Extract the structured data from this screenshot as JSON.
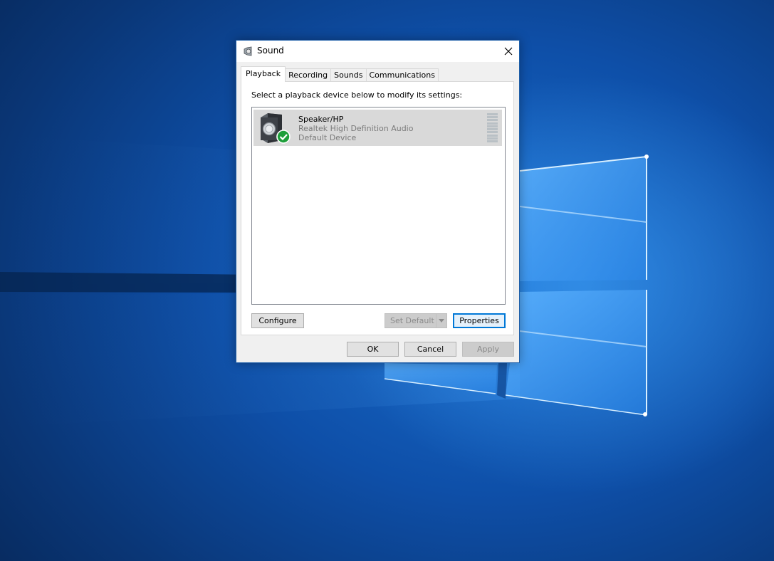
{
  "window": {
    "title": "Sound",
    "close_icon": "close-icon",
    "app_icon": "speaker-icon"
  },
  "tabs": [
    {
      "label": "Playback",
      "active": true
    },
    {
      "label": "Recording",
      "active": false
    },
    {
      "label": "Sounds",
      "active": false
    },
    {
      "label": "Communications",
      "active": false
    }
  ],
  "playback": {
    "instruction": "Select a playback device below to modify its settings:",
    "devices": [
      {
        "name": "Speaker/HP",
        "driver": "Realtek High Definition Audio",
        "status": "Default Device",
        "icon": "speaker-icon",
        "badge": "default-check-icon",
        "selected": true
      }
    ],
    "configure_label": "Configure",
    "set_default_label": "Set Default",
    "properties_label": "Properties"
  },
  "footer": {
    "ok_label": "OK",
    "cancel_label": "Cancel",
    "apply_label": "Apply"
  },
  "colors": {
    "accent": "#0078d7",
    "check_badge": "#1e9e3a",
    "selected_row": "#d9d9d9"
  }
}
